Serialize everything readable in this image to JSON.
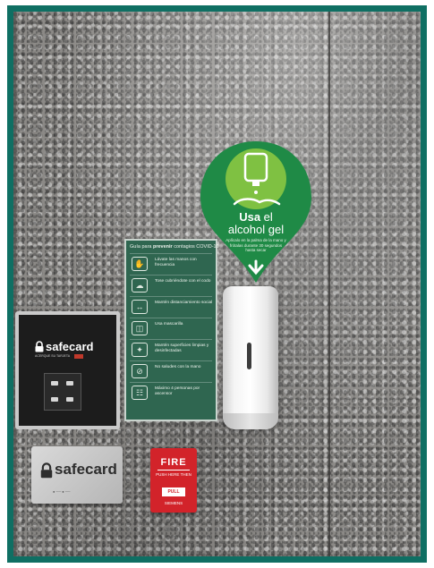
{
  "sanitizer_sign": {
    "title_bold": "Usa",
    "title_rest": " el",
    "title_line2": "alcohol gel",
    "subtitle": "Aplícalo en la palma de la mano y frótalas durante 30 segundos hasta secar"
  },
  "covid_poster": {
    "heading_prefix": "Guía para",
    "heading_bold": " prevenir",
    "heading_suffix": " contagios COVID-19",
    "rules": [
      {
        "icon": "hand-wash-icon",
        "glyph": "✋",
        "text": "Lávate las manos con frecuencia"
      },
      {
        "icon": "cough-icon",
        "glyph": "☁",
        "text": "Tose cubriéndote con el codo"
      },
      {
        "icon": "distance-icon",
        "glyph": "↔",
        "text": "Mantén distanciamiento social"
      },
      {
        "icon": "mask-icon",
        "glyph": "◫",
        "text": "Usa mascarilla"
      },
      {
        "icon": "disinfect-icon",
        "glyph": "✦",
        "text": "Mantén superficies limpias y desinfectadas"
      },
      {
        "icon": "no-face-touch-icon",
        "glyph": "⊘",
        "text": "No saludes con la mano"
      },
      {
        "icon": "group-limit-icon",
        "glyph": "☷",
        "text": "Máximo 4 personas por ascensor"
      }
    ]
  },
  "card_reader": {
    "brand": "safecard",
    "fine_print": "ACERQUE SU TARJETA"
  },
  "safecard_plate": {
    "brand": "safecard",
    "fine_print": "● ── ● ──"
  },
  "fire_alarm": {
    "title": "FIRE",
    "push_text": "PUSH HERE THEN",
    "pull_text": "PULL",
    "brand": "SIEMENS"
  },
  "colors": {
    "frame": "#0f6f63",
    "sign_green": "#1f8a46",
    "sign_light": "#7fc142",
    "poster_green": "#2f6650",
    "fire_red": "#d2232a"
  }
}
